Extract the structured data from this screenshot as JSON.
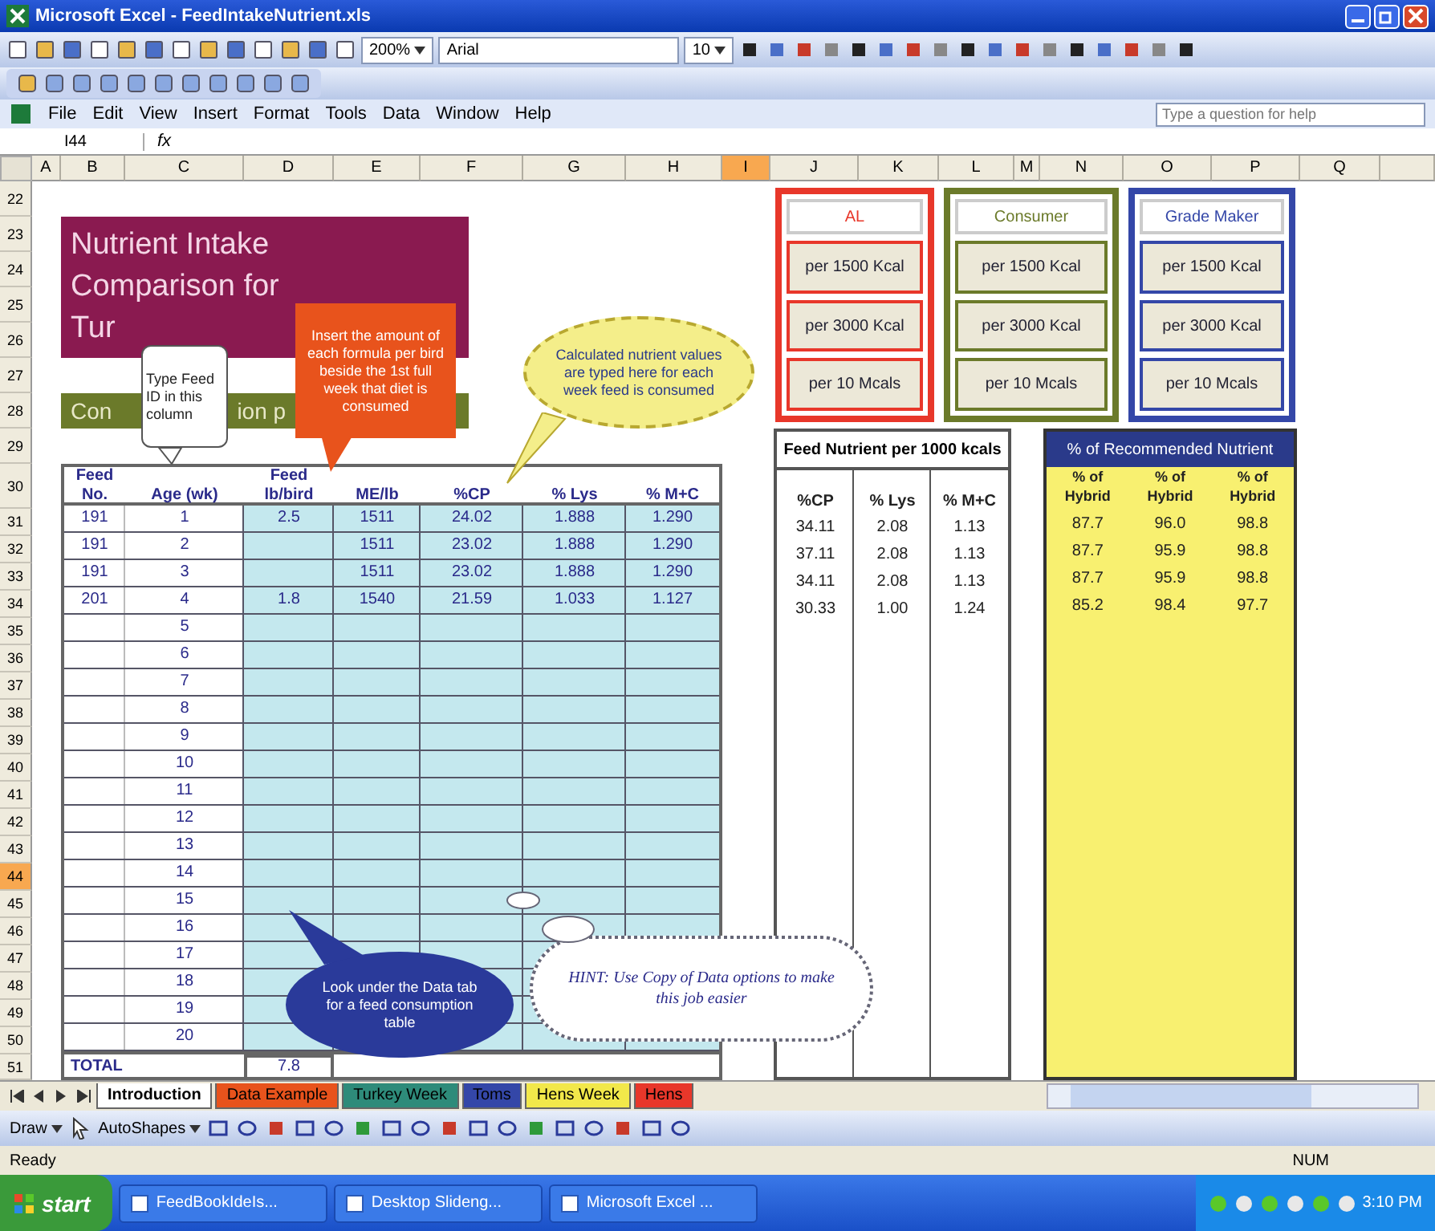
{
  "window": {
    "title": "Microsoft Excel - FeedIntakeNutrient.xls"
  },
  "toolbar": {
    "zoom": "200%",
    "font": "Arial",
    "size": "10"
  },
  "menu": [
    "File",
    "Edit",
    "View",
    "Insert",
    "Format",
    "Tools",
    "Data",
    "Window",
    "Help"
  ],
  "help_box": {
    "placeholder": "Type a question for help"
  },
  "formula_bar": {
    "name_box": "I44",
    "fx": "fx"
  },
  "columns": [
    {
      "label": "A",
      "selected": false
    },
    {
      "label": "B",
      "selected": false
    },
    {
      "label": "C",
      "selected": false
    },
    {
      "label": "D",
      "selected": false
    },
    {
      "label": "E",
      "selected": false
    },
    {
      "label": "F",
      "selected": false
    },
    {
      "label": "G",
      "selected": false
    },
    {
      "label": "H",
      "selected": false
    },
    {
      "label": "I",
      "selected": true
    },
    {
      "label": "J",
      "selected": false
    },
    {
      "label": "K",
      "selected": false
    },
    {
      "label": "L",
      "selected": false
    },
    {
      "label": "M",
      "selected": false
    },
    {
      "label": "N",
      "selected": false
    },
    {
      "label": "O",
      "selected": false
    },
    {
      "label": "P",
      "selected": false
    },
    {
      "label": "Q",
      "selected": false
    }
  ],
  "rows": [
    {
      "label": "22",
      "selected": false
    },
    {
      "label": "23",
      "selected": false
    },
    {
      "label": "24",
      "selected": false
    },
    {
      "label": "25",
      "selected": false
    },
    {
      "label": "26",
      "selected": false
    },
    {
      "label": "27",
      "selected": false
    },
    {
      "label": "28",
      "selected": false
    },
    {
      "label": "29",
      "selected": false
    },
    {
      "label": "30",
      "selected": false
    },
    {
      "label": "31",
      "selected": false
    },
    {
      "label": "32",
      "selected": false
    },
    {
      "label": "33",
      "selected": false
    },
    {
      "label": "34",
      "selected": false
    },
    {
      "label": "35",
      "selected": false
    },
    {
      "label": "36",
      "selected": false
    },
    {
      "label": "37",
      "selected": false
    },
    {
      "label": "38",
      "selected": false
    },
    {
      "label": "39",
      "selected": false
    },
    {
      "label": "40",
      "selected": false
    },
    {
      "label": "41",
      "selected": false
    },
    {
      "label": "42",
      "selected": false
    },
    {
      "label": "43",
      "selected": false
    },
    {
      "label": "44",
      "selected": true
    },
    {
      "label": "45",
      "selected": false
    },
    {
      "label": "46",
      "selected": false
    },
    {
      "label": "47",
      "selected": false
    },
    {
      "label": "48",
      "selected": false
    },
    {
      "label": "49",
      "selected": false
    },
    {
      "label": "50",
      "selected": false
    },
    {
      "label": "51",
      "selected": false
    }
  ],
  "title_block": {
    "lines": [
      "Nutrient Intake",
      "Comparison for",
      "Tur"
    ]
  },
  "subtitle_bar": {
    "left": "Con",
    "right": "ion p"
  },
  "button_groups": [
    {
      "header": "AL",
      "color": "#e8372a",
      "buttons": [
        "per 1500 Kcal",
        "per 3000 Kcal",
        "per 10 Mcals"
      ]
    },
    {
      "header": "Consumer",
      "color": "#6b7a2a",
      "buttons": [
        "per 1500 Kcal",
        "per 3000 Kcal",
        "per 10 Mcals"
      ]
    },
    {
      "header": "Grade Maker",
      "color": "#3447a8",
      "buttons": [
        "per 1500 Kcal",
        "per 3000 Kcal",
        "per 10 Mcals"
      ]
    }
  ],
  "intake_table": {
    "columns": [
      {
        "top": "Feed",
        "label": "No."
      },
      {
        "label": "Age (wk)"
      },
      {
        "top": "Feed",
        "label": "lb/bird"
      },
      {
        "label": "ME/lb"
      },
      {
        "label": "%CP"
      },
      {
        "label": "% Lys"
      },
      {
        "label": "% M+C"
      }
    ],
    "rows": [
      [
        "191",
        "1",
        "2.5",
        "1511",
        "24.02",
        "1.888",
        "1.290"
      ],
      [
        "191",
        "2",
        "",
        "1511",
        "23.02",
        "1.888",
        "1.290"
      ],
      [
        "191",
        "3",
        "",
        "1511",
        "23.02",
        "1.888",
        "1.290"
      ],
      [
        "201",
        "4",
        "1.8",
        "1540",
        "21.59",
        "1.033",
        "1.127"
      ],
      [
        "",
        "5",
        "",
        "",
        "",
        "",
        ""
      ],
      [
        "",
        "6",
        "",
        "",
        "",
        "",
        ""
      ],
      [
        "",
        "7",
        "",
        "",
        "",
        "",
        ""
      ],
      [
        "",
        "8",
        "",
        "",
        "",
        "",
        ""
      ],
      [
        "",
        "9",
        "",
        "",
        "",
        "",
        ""
      ],
      [
        "",
        "10",
        "",
        "",
        "",
        "",
        ""
      ],
      [
        "",
        "11",
        "",
        "",
        "",
        "",
        ""
      ],
      [
        "",
        "12",
        "",
        "",
        "",
        "",
        ""
      ],
      [
        "",
        "13",
        "",
        "",
        "",
        "",
        ""
      ],
      [
        "",
        "14",
        "",
        "",
        "",
        "",
        ""
      ],
      [
        "",
        "15",
        "",
        "",
        "",
        "",
        ""
      ],
      [
        "",
        "16",
        "",
        "",
        "",
        "",
        ""
      ],
      [
        "",
        "17",
        "",
        "",
        "",
        "",
        ""
      ],
      [
        "",
        "18",
        "",
        "",
        "",
        "",
        ""
      ],
      [
        "",
        "19",
        "",
        "",
        "",
        "",
        ""
      ],
      [
        "",
        "20",
        "",
        "",
        "",
        "",
        ""
      ]
    ],
    "total": {
      "label": "TOTAL",
      "value": "7.8"
    }
  },
  "nutrient_table": {
    "title": "Feed Nutrient per 1000 kcals",
    "columns": [
      "%CP",
      "% Lys",
      "% M+C"
    ],
    "rows": [
      [
        "34.11",
        "2.08",
        "1.13"
      ],
      [
        "37.11",
        "2.08",
        "1.13"
      ],
      [
        "34.11",
        "2.08",
        "1.13"
      ],
      [
        "30.33",
        "1.00",
        "1.24"
      ]
    ]
  },
  "recommended_table": {
    "title": "% of Recommended Nutrient",
    "columns": [
      {
        "top": "% of",
        "label": "Hybrid"
      },
      {
        "top": "% of",
        "label": "Hybrid"
      },
      {
        "top": "% of",
        "label": "Hybrid"
      }
    ],
    "rows": [
      [
        "87.7",
        "96.0",
        "98.8"
      ],
      [
        "87.7",
        "95.9",
        "98.8"
      ],
      [
        "87.7",
        "95.9",
        "98.8"
      ],
      [
        "85.2",
        "98.4",
        "97.7"
      ]
    ]
  },
  "callouts": [
    {
      "kind": "note",
      "text": "Type Feed ID in this column"
    },
    {
      "kind": "box",
      "text": "Insert the amount of each formula per bird beside the 1st full week that diet is consumed"
    },
    {
      "kind": "bubble",
      "text": "Calculated nutrient values are typed here for each week feed is consumed"
    },
    {
      "kind": "oval",
      "text": "Look under the Data tab for a feed consumption table"
    },
    {
      "kind": "cloud",
      "text": "HINT: Use Copy of Data options to make this job easier"
    }
  ],
  "sheet_tabs": [
    {
      "label": "Introduction",
      "selected": true,
      "color": "#ffffff"
    },
    {
      "label": "Data Example",
      "selected": false,
      "color": "#e8531c"
    },
    {
      "label": "Turkey Week",
      "selected": false,
      "color": "#2e8b7a"
    },
    {
      "label": "Toms",
      "selected": false,
      "color": "#3447a8"
    },
    {
      "label": "Hens Week",
      "selected": false,
      "color": "#f2e84a"
    },
    {
      "label": "Hens",
      "selected": false,
      "color": "#e8372a"
    }
  ],
  "drawing_toolbar": {
    "draw": "Draw",
    "autoshapes": "AutoShapes"
  },
  "status_bar": {
    "left": "Ready",
    "right": "NUM"
  },
  "taskbar": {
    "start": "start",
    "items": [
      "FeedBookIdeIs...",
      "Desktop Slideng...",
      "Microsoft Excel ..."
    ],
    "clock": "3:10 PM"
  }
}
